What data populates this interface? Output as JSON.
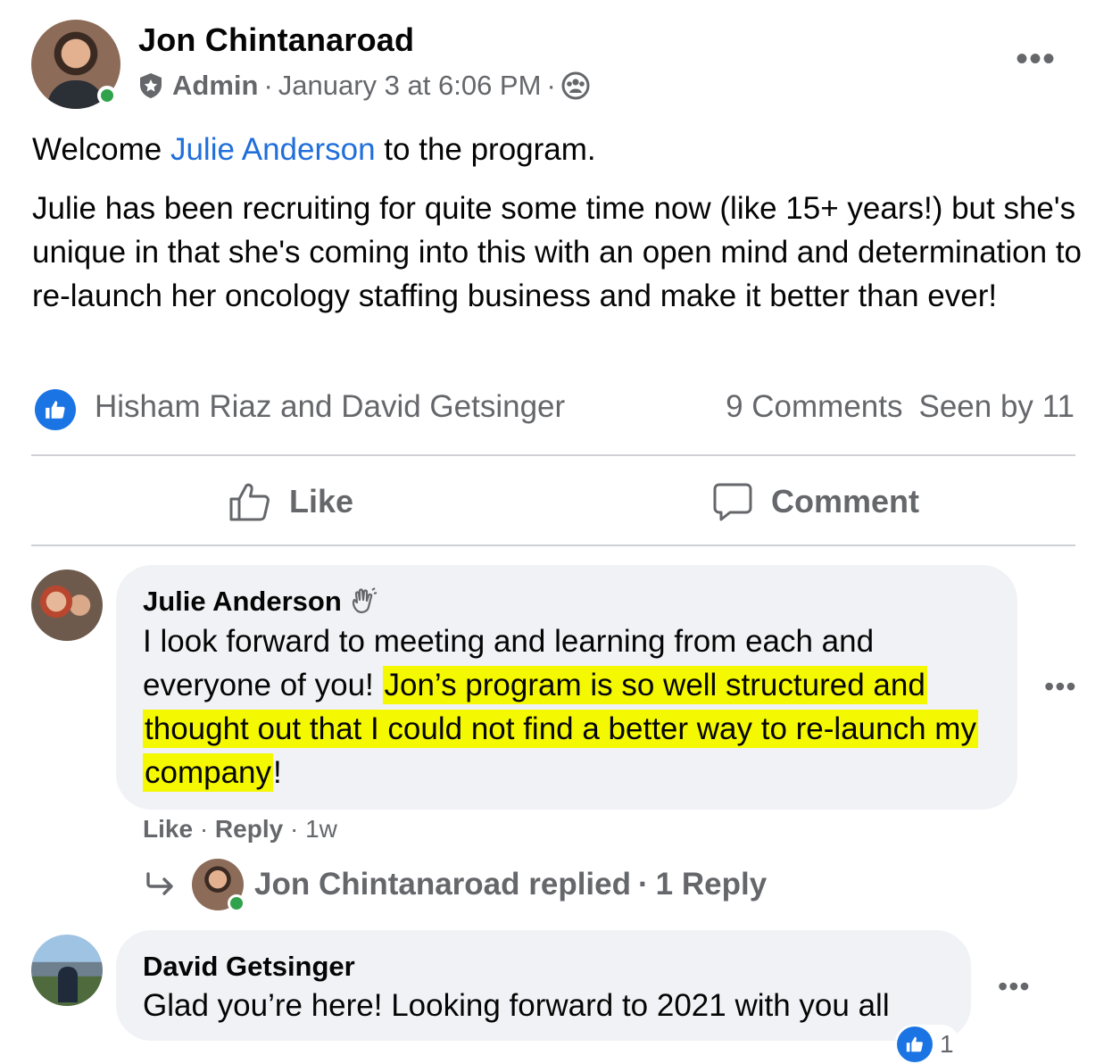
{
  "post": {
    "author": "Jon Chintanaroad",
    "role": "Admin",
    "timestamp": "January 3 at 6:06 PM",
    "separator": "·",
    "audience_icon": "group-members-icon",
    "more_icon": "more-dots-icon",
    "more_label": "•••",
    "welcome_before": "Welcome ",
    "welcome_mention": "Julie Anderson",
    "welcome_after": " to the program.",
    "body": "Julie has been recruiting for quite some time now (like 15+ years!) but she's unique in that she's coming into this with an open mind and determination to re-launch her oncology staffing business and make it better than ever!"
  },
  "reactions": {
    "icon": "like-reaction-icon",
    "names": "Hisham Riaz and David Getsinger",
    "comments": "9 Comments",
    "seen": "Seen by 11"
  },
  "actions": {
    "like_label": "Like",
    "comment_label": "Comment"
  },
  "comments": [
    {
      "author": "Julie Anderson",
      "badge_icon": "wave-hand-icon",
      "text_plain": "I look forward to meeting and learning from each and everyone of you! ",
      "text_highlighted": "Jon’s program is so well structured and thought out that I could not find a better way to re-launch my company",
      "text_end": "!",
      "like_label": "Like",
      "reply_label": "Reply",
      "age": "1w",
      "reply_summary": {
        "name": "Jon Chintanaroad replied",
        "count": "1 Reply"
      }
    },
    {
      "author": "David Getsinger",
      "text": "Glad you’re here! Looking forward to 2021 with you all",
      "reaction_count": "1"
    }
  ],
  "colors": {
    "accent": "#1b74e4",
    "mention": "#216fdb",
    "highlight": "#f4f800",
    "online": "#31a24c",
    "muted": "#65676b"
  }
}
